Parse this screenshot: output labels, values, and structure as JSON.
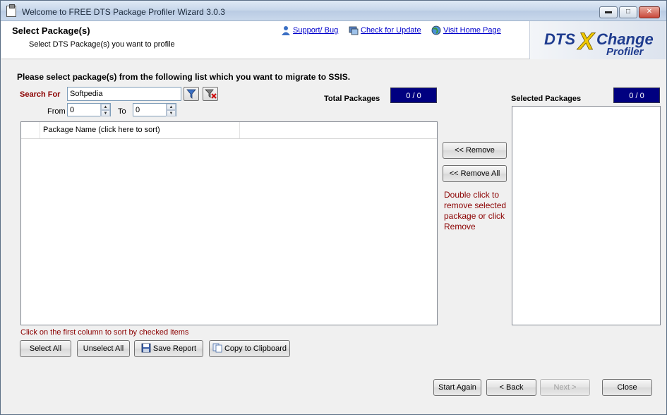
{
  "window": {
    "title": "Welcome to FREE DTS Package Profiler Wizard 3.0.3",
    "controls": {
      "minimize": "▬",
      "maximize": "□",
      "close": "✕"
    }
  },
  "header": {
    "title": "Select Package(s)",
    "subtitle": "Select DTS Package(s) you want to profile",
    "links": {
      "support": "Support/ Bug",
      "update": "Check for Update",
      "home": "Visit Home Page"
    },
    "logo": {
      "line1_a": "DTS",
      "line1_b": "X",
      "line1_c": "Change",
      "line2": "Profiler"
    }
  },
  "instructions": "Please select package(s) from the following list which you want to migrate to SSIS.",
  "search": {
    "label": "Search For",
    "value": "Softpedia",
    "from_label": "From",
    "from_value": "0",
    "to_label": "To",
    "to_value": "0"
  },
  "total": {
    "label": "Total Packages",
    "value": "0 / 0"
  },
  "selected": {
    "label": "Selected Packages",
    "value": "0 / 0"
  },
  "grid": {
    "columns": [
      "",
      "Package Name (click here to sort)",
      ""
    ]
  },
  "middle": {
    "remove": "<< Remove",
    "remove_all": "<< Remove All",
    "hint": "Double click to remove selected package or click Remove"
  },
  "sort_hint": "Click on the first column to sort by checked items",
  "bottom_buttons": {
    "select_all": "Select All",
    "unselect_all": "Unselect All",
    "save_report": "Save Report",
    "copy_clipboard": "Copy to Clipboard"
  },
  "nav": {
    "start_again": "Start Again",
    "back": "< Back",
    "next": "Next >",
    "close": "Close"
  },
  "colors": {
    "counter_bg": "#000080",
    "hint_text": "#8b0000",
    "link": "#0000cc",
    "logo_blue": "#1f3c8f",
    "logo_yellow": "#f0c800"
  }
}
